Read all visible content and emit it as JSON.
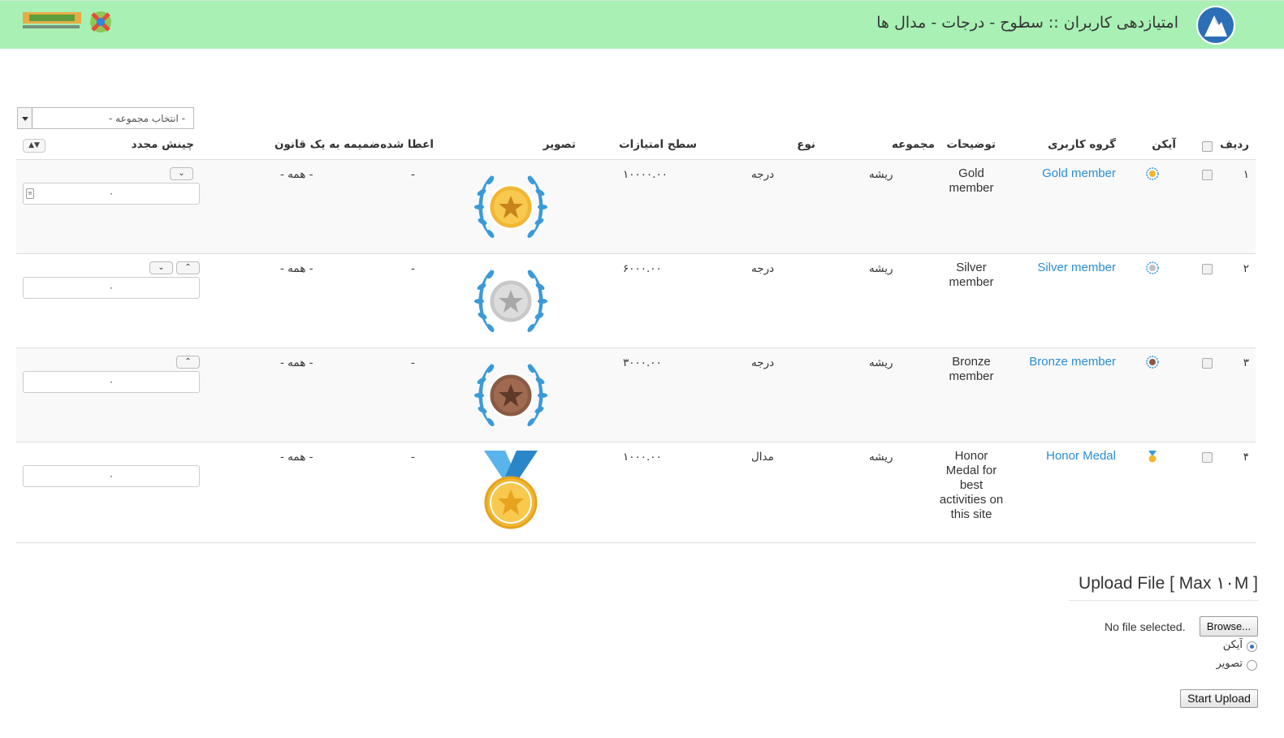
{
  "header": {
    "title": "امتیازدهی کاربران :: سطوح - درجات - مدال ها",
    "logo_icon": "joomla-mountain-logo-icon",
    "brand_icon": "joomla-store-brand-logo",
    "background": "#a8f0b4"
  },
  "filter": {
    "category_select": "- انتخاب مجموعه -"
  },
  "table": {
    "headers": {
      "row": "ردیف",
      "icon": "آیکن",
      "group": "گروه کاربری",
      "description": "توضیحات",
      "set": "مجموعه",
      "type": "نوع",
      "points": "سطح امتیازات",
      "image": "تصویر",
      "awarded": "اعطا شده",
      "rule": "ضمیمه به یک قانون",
      "reorder": "چینش مجدد"
    },
    "rows": [
      {
        "num": "۱",
        "group": "Gold member",
        "description": "Gold member",
        "set": "ریشه",
        "type": "درجه",
        "points": "۱۰۰۰۰.۰۰",
        "awarded": "-",
        "rule": "- همه -",
        "order": "۰",
        "medal": "gold-wreath",
        "color": "#f2b632"
      },
      {
        "num": "۲",
        "group": "Silver member",
        "description": "Silver member",
        "set": "ریشه",
        "type": "درجه",
        "points": "۶۰۰۰.۰۰",
        "awarded": "-",
        "rule": "- همه -",
        "order": "۰",
        "medal": "silver-wreath",
        "color": "#c0c0c0"
      },
      {
        "num": "۳",
        "group": "Bronze member",
        "description": "Bronze member",
        "set": "ریشه",
        "type": "درجه",
        "points": "۳۰۰۰.۰۰",
        "awarded": "-",
        "rule": "- همه -",
        "order": "۰",
        "medal": "bronze-wreath",
        "color": "#8a5a44"
      },
      {
        "num": "۴",
        "group": "Honor Medal",
        "description": "Honor Medal for best activities on this site",
        "set": "ریشه",
        "type": "مدال",
        "points": "۱۰۰۰.۰۰",
        "awarded": "-",
        "rule": "- همه -",
        "order": "۰",
        "medal": "ribbon-medal",
        "color": "#f2b632"
      }
    ]
  },
  "upload": {
    "title": "Upload File [ Max ۱۰M ]",
    "browse": "Browse...",
    "no_file": "No file selected.",
    "radio_icon": "آیکن",
    "radio_image": "تصویر",
    "start": "Start Upload"
  },
  "colors": {
    "link": "#2a8dd4",
    "wreath": "#3a9ad9"
  }
}
